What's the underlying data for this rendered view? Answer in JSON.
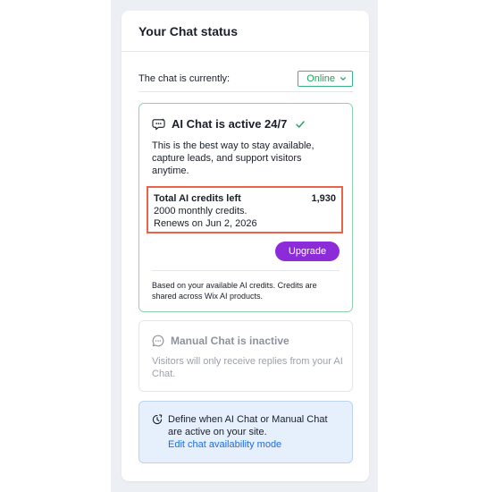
{
  "panel": {
    "title": "Your Chat status"
  },
  "status": {
    "label": "The chat is currently:",
    "value": "Online",
    "color": "#1e9e5c"
  },
  "ai_card": {
    "title": "AI Chat is active 24/7",
    "description": "This is the best way to stay available, capture leads, and support visitors anytime.",
    "credits_label": "Total AI credits left",
    "credits_value": "1,930",
    "monthly_credits": "2000 monthly credits.",
    "renews": "Renews on Jun 2, 2026",
    "upgrade_label": "Upgrade",
    "footnote": "Based on your available AI credits. Credits are shared across Wix AI products.",
    "accent_color": "#8c2bd8",
    "highlight_color": "#e8634a"
  },
  "manual_card": {
    "title": "Manual Chat is inactive",
    "description": "Visitors will only receive replies from your AI Chat."
  },
  "info": {
    "text": "Define when AI Chat or Manual Chat are active on your site.",
    "link": "Edit chat availability mode"
  },
  "icons": {
    "ai_chat": "ai-chat-icon",
    "active_check": "check-icon",
    "manual_chat": "chat-bubble-icon",
    "availability": "clock-icon",
    "dropdown": "chevron-down-icon"
  }
}
